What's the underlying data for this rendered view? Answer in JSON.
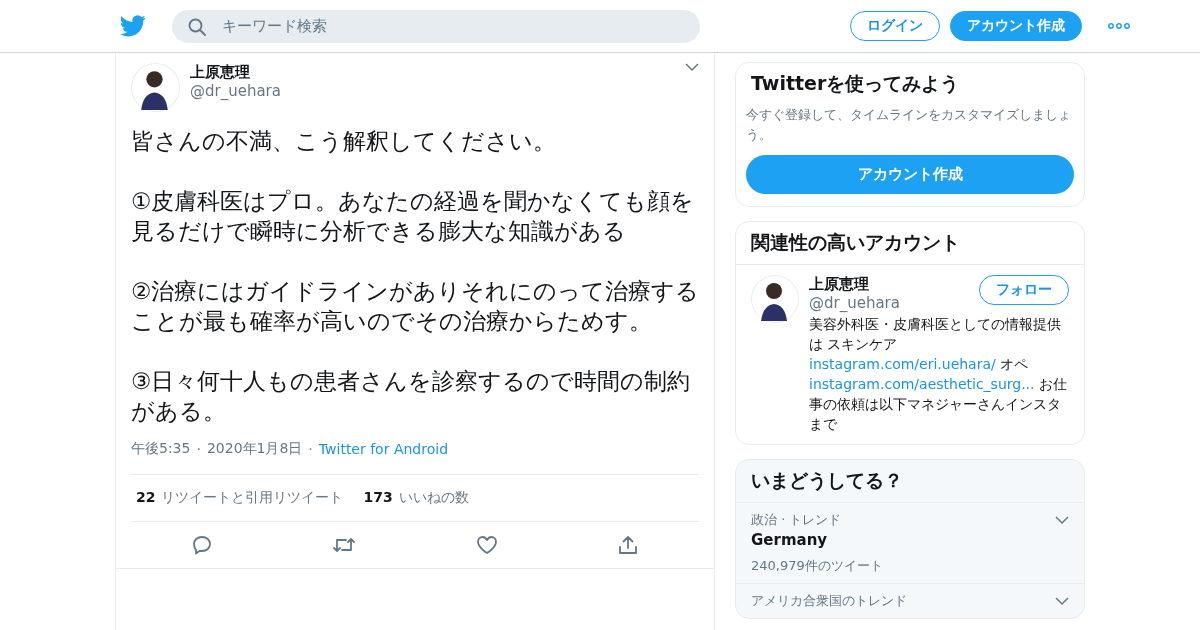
{
  "header": {
    "search": {
      "placeholder": "キーワード検索"
    },
    "login": "ログイン",
    "signup": "アカウント作成"
  },
  "tweet": {
    "name": "上原恵理",
    "handle": "@dr_uehara",
    "paragraphs": [
      "皆さんの不満、こう解釈してください。",
      "①皮膚科医はプロ。あなたの経過を聞かなくても顔を見るだけで瞬時に分析できる膨大な知識がある",
      "②治療にはガイドラインがありそれにのって治療することが最も確率が高いのでその治療からためす。",
      "③日々何十人もの患者さんを診察するので時間の制約がある。"
    ],
    "time": "午後5:35",
    "separator": "·",
    "date": "2020年1月8日",
    "source": "Twitter for Android",
    "stats": [
      {
        "count": "22",
        "label": "リツイートと引用リツイート"
      },
      {
        "count": "173",
        "label": "いいねの数"
      }
    ]
  },
  "signup_card": {
    "title": "Twitterを使ってみよう",
    "text": "今すぐ登録して、タイムラインをカスタマイズしましょう。",
    "button": "アカウント作成"
  },
  "related": {
    "title": "関連性の高いアカウント",
    "accounts": [
      {
        "name": "上原恵理",
        "handle": "@dr_uehara",
        "button": "フォロー",
        "bio": [
          {
            "kind": "text",
            "text": "美容外科医・皮膚科医としての情報提供は スキンケア "
          },
          {
            "kind": "link",
            "text": "instagram.com/eri.uehara/"
          },
          {
            "kind": "text",
            "text": " オペ "
          },
          {
            "kind": "link",
            "text": "instagram.com/aesthetic_surg..."
          },
          {
            "kind": "text",
            "text": " お仕事の依頼は以下マネジャーさんインスタまで"
          }
        ]
      }
    ]
  },
  "trends": {
    "title": "いまどうしてる？",
    "items": [
      {
        "category": "政治 · トレンド",
        "topic": "Germany",
        "count": "240,979件のツイート"
      },
      {
        "category": "アメリカ合衆国のトレンド"
      }
    ]
  }
}
